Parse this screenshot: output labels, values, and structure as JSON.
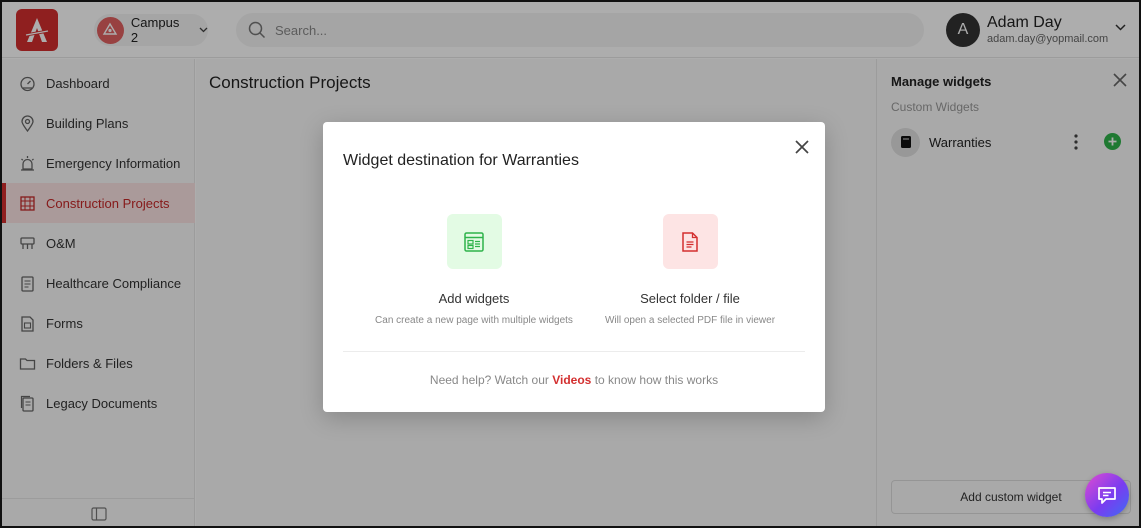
{
  "header": {
    "campus_name": "Campus 2",
    "search_placeholder": "Search...",
    "user": {
      "initial": "A",
      "name": "Adam Day",
      "email": "adam.day@yopmail.com"
    }
  },
  "sidebar": {
    "items": [
      {
        "label": "Dashboard",
        "icon": "dashboard-icon",
        "active": false
      },
      {
        "label": "Building Plans",
        "icon": "map-pin-icon",
        "active": false
      },
      {
        "label": "Emergency Information",
        "icon": "alarm-icon",
        "active": false
      },
      {
        "label": "Construction Projects",
        "icon": "construction-icon",
        "active": true
      },
      {
        "label": "O&M",
        "icon": "maintenance-icon",
        "active": false
      },
      {
        "label": "Healthcare Compliance",
        "icon": "clipboard-icon",
        "active": false
      },
      {
        "label": "Forms",
        "icon": "form-icon",
        "active": false
      },
      {
        "label": "Folders & Files",
        "icon": "folder-icon",
        "active": false
      },
      {
        "label": "Legacy Documents",
        "icon": "document-stack-icon",
        "active": false
      }
    ]
  },
  "main": {
    "title": "Construction Projects"
  },
  "panel": {
    "title": "Manage widgets",
    "subtitle": "Custom Widgets",
    "widgets": [
      {
        "label": "Warranties"
      }
    ],
    "add_button": "Add custom widget"
  },
  "modal": {
    "title": "Widget destination for Warranties",
    "options": [
      {
        "label": "Add widgets",
        "description": "Can create a new page with multiple widgets",
        "tile_color": "#e3fbe4",
        "icon_color": "#2eb34a"
      },
      {
        "label": "Select folder / file",
        "description": "Will open a selected PDF file in viewer",
        "tile_color": "#fde4e4",
        "icon_color": "#d32f2f"
      }
    ],
    "help_prefix": "Need help? Watch our",
    "help_link": "Videos",
    "help_suffix": "to know how this works"
  },
  "colors": {
    "brand": "#d32f2f",
    "active_bg": "#fbe3e3",
    "success": "#2eb34a"
  }
}
